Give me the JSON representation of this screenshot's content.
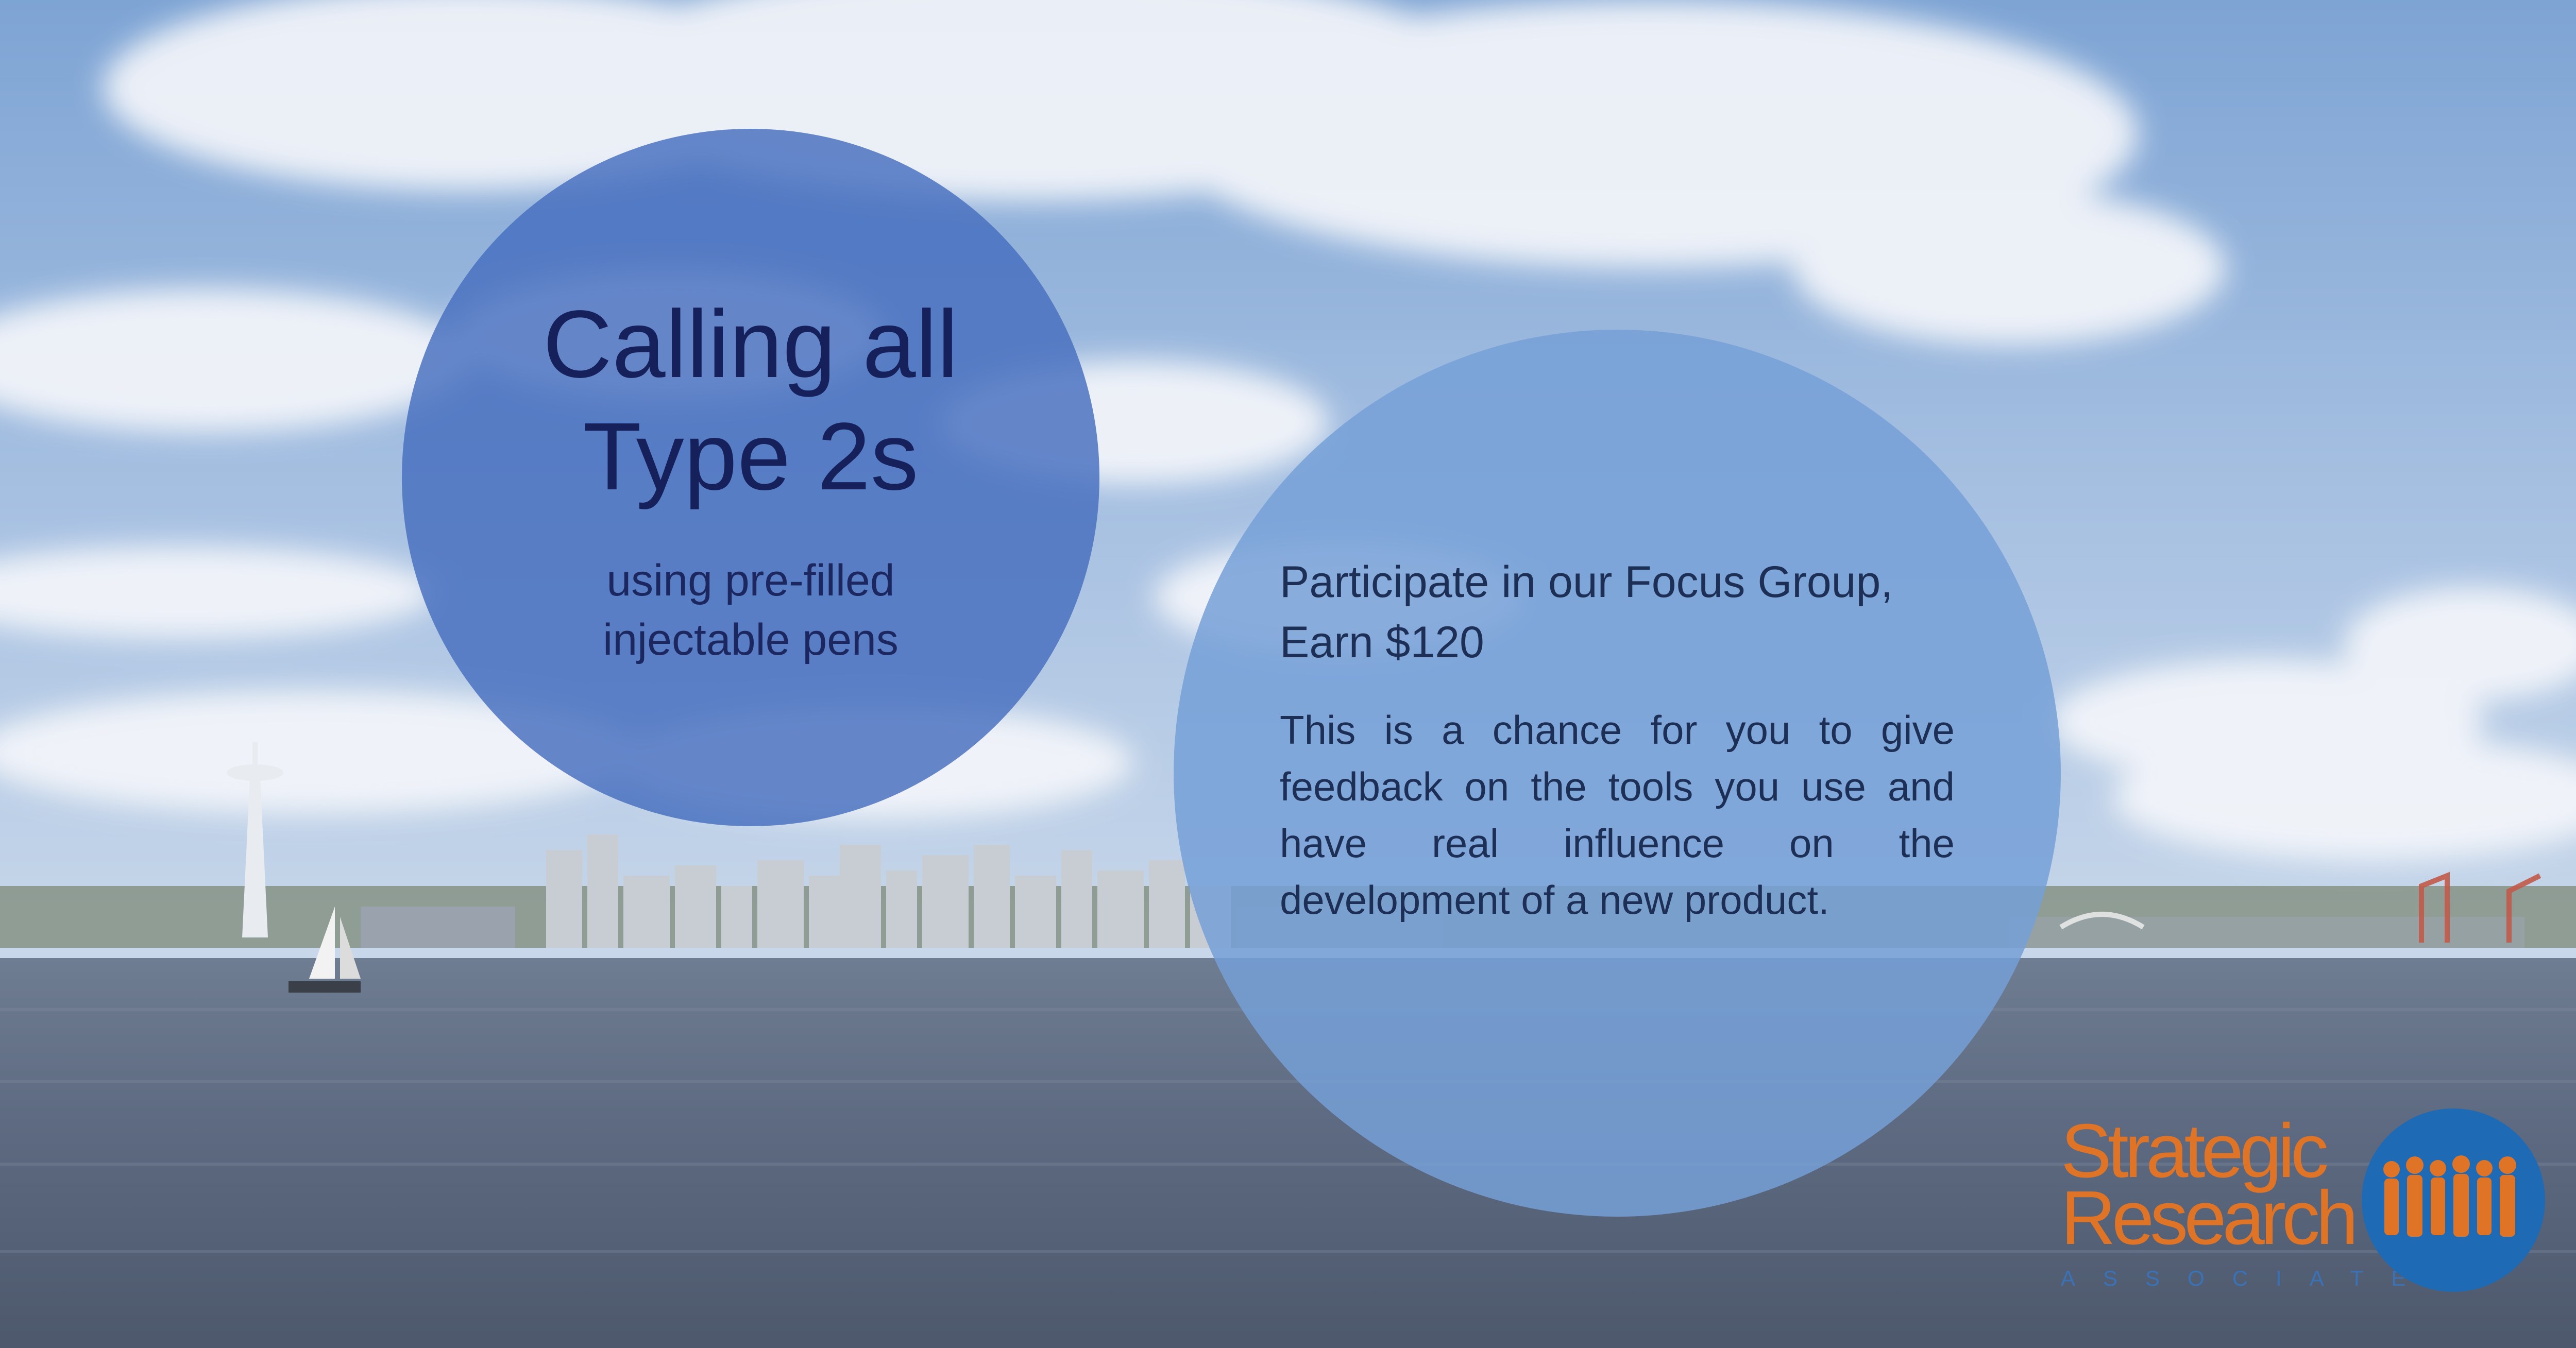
{
  "headline": {
    "line1": "Calling all",
    "line2": "Type 2s"
  },
  "subhead": {
    "line1": "using pre-filled",
    "line2": "injectable pens"
  },
  "offer": {
    "title_line1": "Participate in our Focus Group,",
    "title_line2": "Earn $120",
    "body": "This is a chance for you to give feedback on the tools you use and have real influence on the development of a new product."
  },
  "logo": {
    "word1": "Strategic",
    "word2": "Research",
    "word3": "ASSOCIATES",
    "orange": "#e07426",
    "blue": "#1f6ab5"
  },
  "colors": {
    "sky": "#8fb0d8",
    "water": "#5b6a82",
    "left_circle": "#466ebe",
    "right_circle": "#76a0d7",
    "headline_text": "#16205a"
  },
  "icons": [
    "space-needle-icon",
    "sailboat-icon",
    "people-silhouette-icon"
  ]
}
